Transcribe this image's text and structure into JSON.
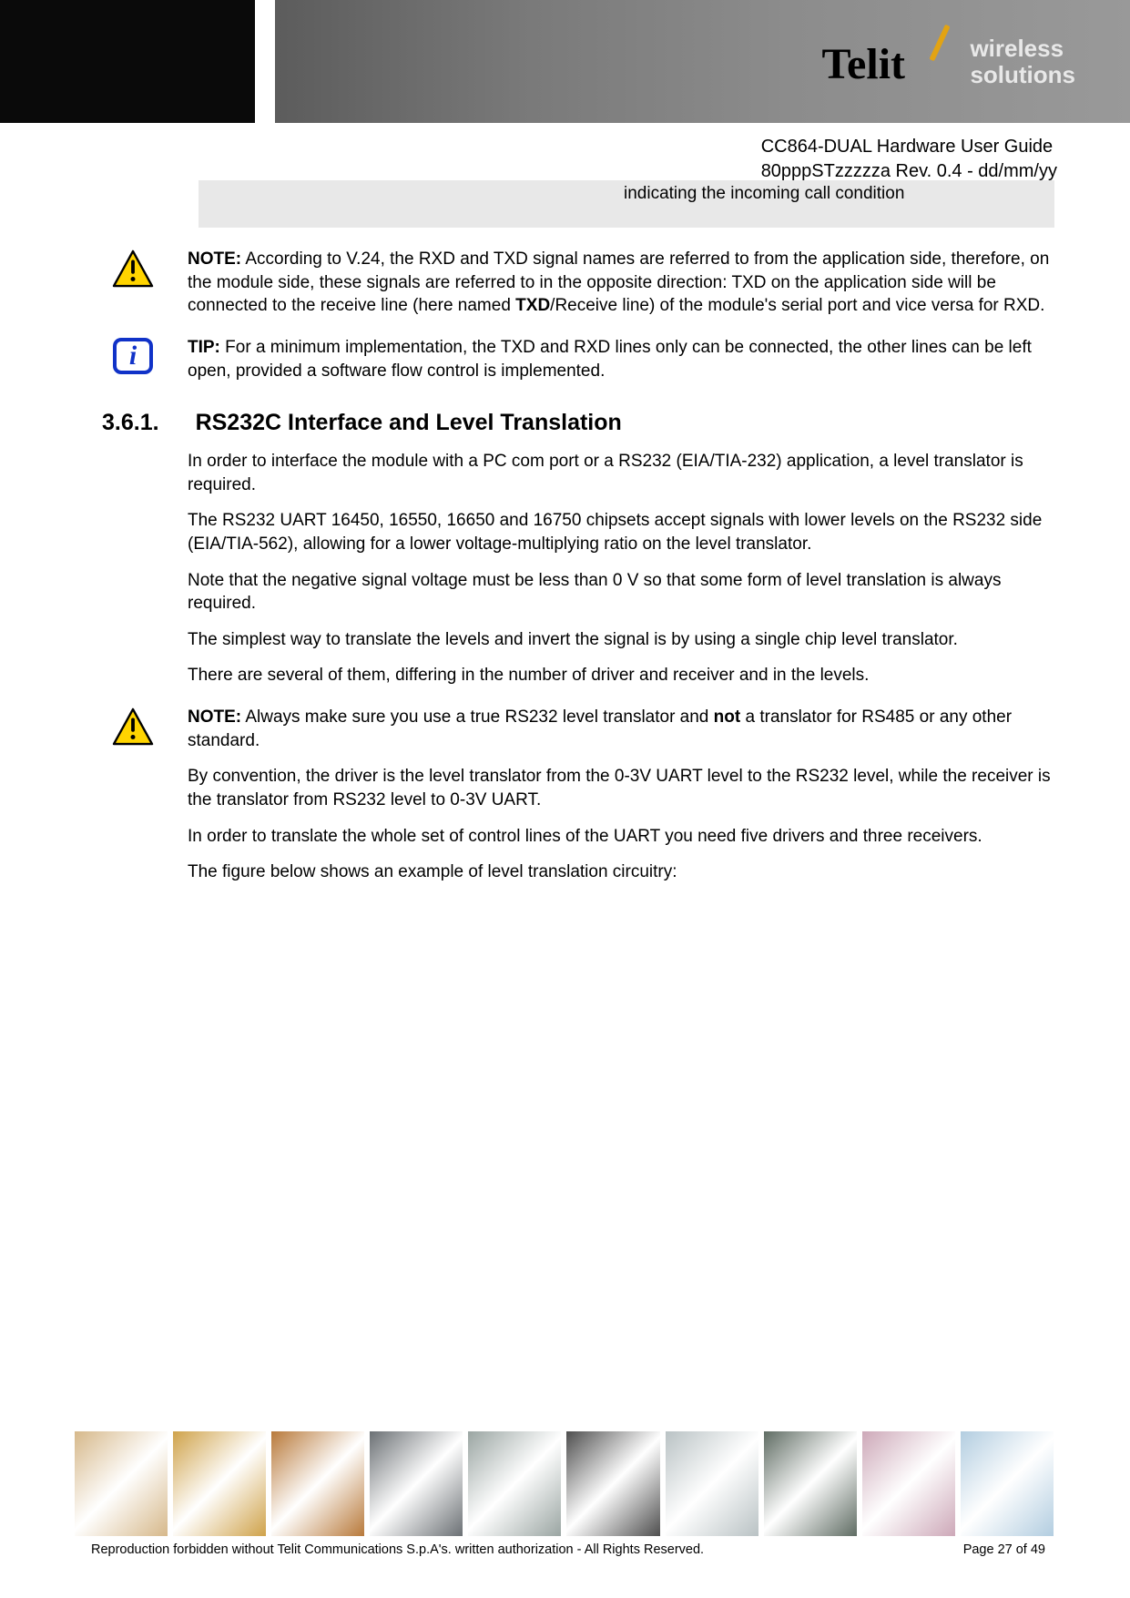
{
  "header": {
    "brand": "Telit",
    "tagline_l1": "wireless",
    "tagline_l2": "solutions"
  },
  "doc": {
    "title": "CC864-DUAL Hardware User Guide",
    "rev": "80pppSTzzzzza Rev. 0.4 - dd/mm/yy"
  },
  "table_fragment_text": "indicating the incoming call condition",
  "note1": {
    "label": "NOTE:",
    "text_part1": " According to V.24, the RXD and TXD signal names are referred to from the application side, therefore, on the module side, these signals are referred to in the opposite direction: TXD on the application side will be connected to the receive line (here named ",
    "bold_inline": "TXD",
    "text_part2": "/Receive line) of the module's serial port and vice versa for RXD."
  },
  "tip": {
    "label": "TIP:",
    "text": " For a minimum implementation, the TXD and RXD lines only can be connected, the other lines can be left open, provided a software flow control is implemented."
  },
  "section": {
    "num": "3.6.1.",
    "title": "RS232C Interface and Level Translation"
  },
  "paras": {
    "p1": "In order to interface the module with a PC com port or a RS232 (EIA/TIA-232) application, a level translator is required.",
    "p2": "The RS232 UART 16450, 16550, 16650 and 16750 chipsets accept signals with lower levels on the RS232 side (EIA/TIA-562), allowing for a lower voltage-multiplying ratio on the level translator.",
    "p3": "Note that the negative signal voltage must be less than 0 V so that some form of level translation is always required.",
    "p4": "The simplest way to translate the levels and invert the signal is by using a single chip level translator.",
    "p5": "There are several of them, differing in the number of driver and receiver and in the levels."
  },
  "note2": {
    "label": "NOTE:",
    "text_a": " Always make sure you use a true RS232 level translator and ",
    "bold_inline": "not",
    "text_b": " a translator for RS485 or any other standard."
  },
  "paras2": {
    "p6": "By convention, the driver is the level translator from the 0-3V UART level to the RS232 level, while the receiver is the translator from RS232 level to 0-3V UART.",
    "p7": "In order to translate the whole set of control lines of the UART you need five drivers and three receivers.",
    "p8": "The figure below shows an example of level translation circuitry:"
  },
  "footer": {
    "copyright": "Reproduction forbidden without Telit Communications S.p.A's. written authorization - All Rights Reserved.",
    "page": "Page 27 of 49"
  },
  "tile_colors": [
    "#d6b88a",
    "#cfa24a",
    "#b8793a",
    "#6b7074",
    "#9aa5a2",
    "#4e4e4e",
    "#b9c2c4",
    "#5f6c63",
    "#cda8b8",
    "#b2cde0"
  ]
}
